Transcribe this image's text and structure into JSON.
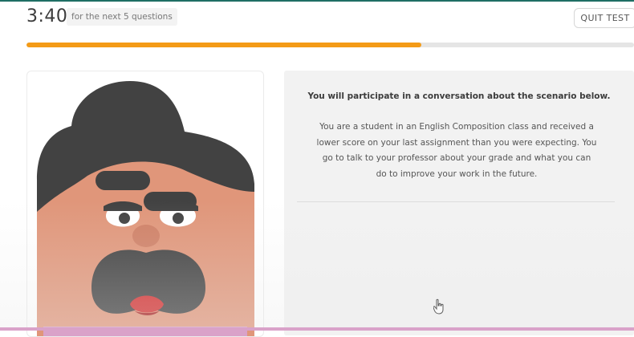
{
  "header": {
    "timer": "3:40",
    "timer_note": "for the next 5 questions",
    "quit_label": "QUIT TEST"
  },
  "progress": {
    "fraction": 0.65
  },
  "scenario": {
    "heading": "You will participate in a conversation about the scenario below.",
    "body": "You are a student in an English Composition class and received a lower score on your last assignment than you were expecting. You go to talk to your professor about your grade and what you can do to improve your work in the future."
  },
  "colors": {
    "accent": "#f49b17",
    "track": "#e5e5e5",
    "skin": "#e0967a",
    "hair": "#424242",
    "lip": "#d23030"
  },
  "icons": [
    "professor-avatar",
    "hand-cursor-icon"
  ]
}
